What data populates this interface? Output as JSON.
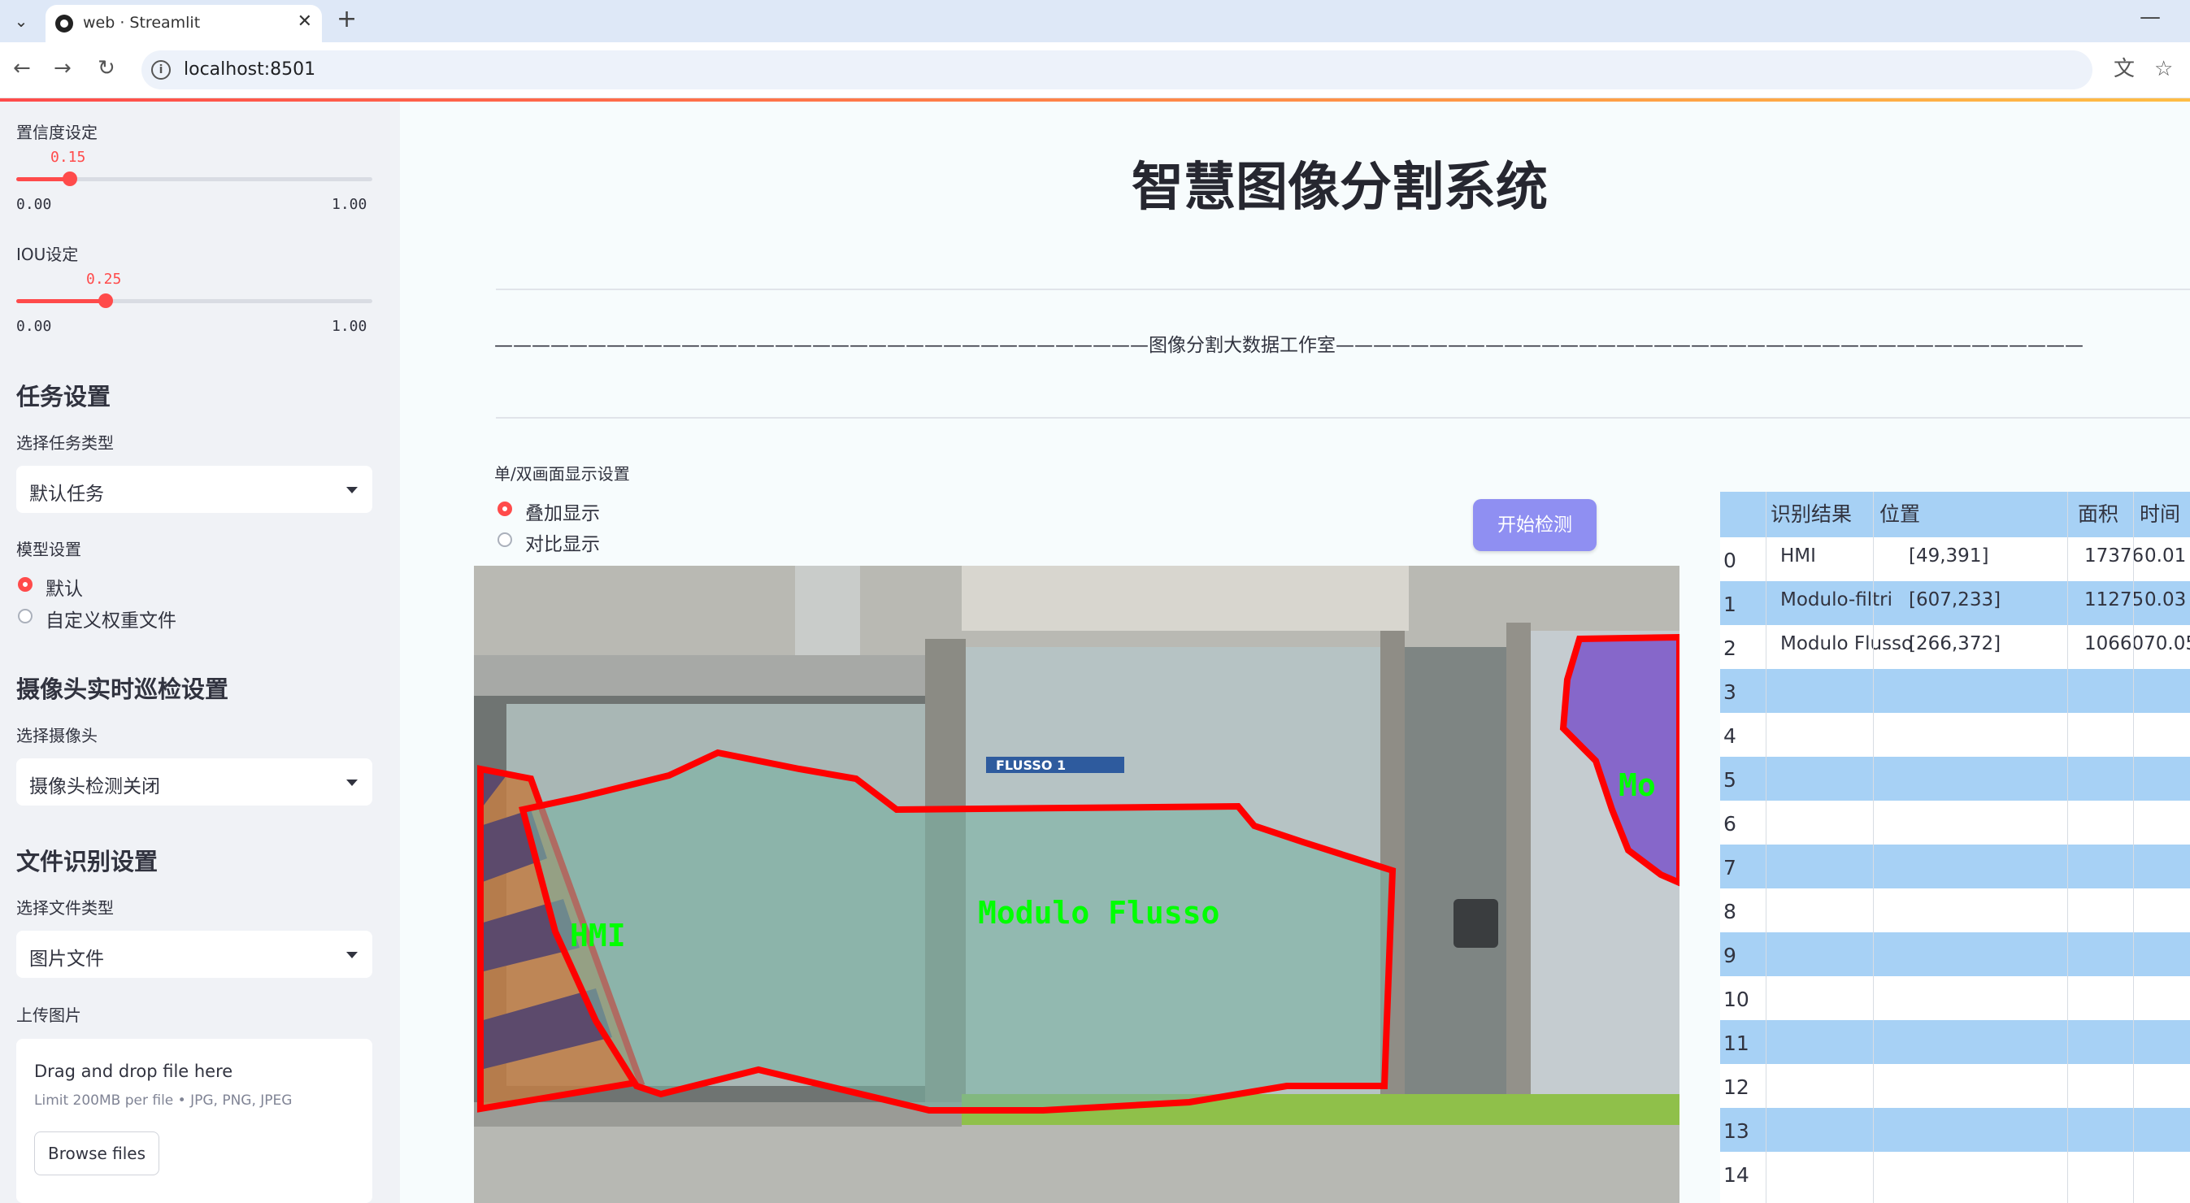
{
  "browser": {
    "tab_title": "web · Streamlit",
    "url": "localhost:8501"
  },
  "sidebar": {
    "confidence": {
      "label": "置信度设定",
      "value": "0.15",
      "fraction": 0.15,
      "min": "0.00",
      "max": "1.00"
    },
    "iou": {
      "label": "IOU设定",
      "value": "0.25",
      "fraction": 0.25,
      "min": "0.00",
      "max": "1.00"
    },
    "task_header": "任务设置",
    "task_type_label": "选择任务类型",
    "task_type_value": "默认任务",
    "model_label": "模型设置",
    "model_options": [
      "默认",
      "自定义权重文件"
    ],
    "model_selected": 0,
    "camera_header": "摄像头实时巡检设置",
    "camera_label": "选择摄像头",
    "camera_value": "摄像头检测关闭",
    "file_header": "文件识别设置",
    "file_type_label": "选择文件类型",
    "file_type_value": "图片文件",
    "upload_label": "上传图片",
    "upload_title": "Drag and drop file here",
    "upload_limit": "Limit 200MB per file • JPG, PNG, JPEG",
    "upload_button": "Browse files"
  },
  "main": {
    "title": "智慧图像分割系统",
    "studio_line": "———————————————————————————————————图像分割大数据工作室————————————————————————————————————————",
    "display_label": "单/双画面显示设置",
    "display_options": [
      "叠加显示",
      "对比显示"
    ],
    "display_selected": 0,
    "detect_button": "开始检测",
    "image_labels": {
      "hmi": "HMI",
      "flusso": "Modulo Flusso",
      "panel_text": "FLUSSO 1",
      "right_partial": "Mo"
    }
  },
  "table": {
    "columns": [
      "识别结果",
      "位置",
      "面积",
      "时间"
    ],
    "rows": [
      {
        "index": "0",
        "result": "HMI",
        "position": "[49,391]",
        "area": "17376",
        "time": "0.01"
      },
      {
        "index": "1",
        "result": "Modulo-filtri",
        "position": "[607,233]",
        "area": "11275",
        "time": "0.03"
      },
      {
        "index": "2",
        "result": "Modulo Flusso",
        "position": "[266,372]",
        "area": "1066070.05",
        "time": ""
      },
      {
        "index": "3",
        "result": "",
        "position": "",
        "area": "",
        "time": ""
      },
      {
        "index": "4",
        "result": "",
        "position": "",
        "area": "",
        "time": ""
      },
      {
        "index": "5",
        "result": "",
        "position": "",
        "area": "",
        "time": ""
      },
      {
        "index": "6",
        "result": "",
        "position": "",
        "area": "",
        "time": ""
      },
      {
        "index": "7",
        "result": "",
        "position": "",
        "area": "",
        "time": ""
      },
      {
        "index": "8",
        "result": "",
        "position": "",
        "area": "",
        "time": ""
      },
      {
        "index": "9",
        "result": "",
        "position": "",
        "area": "",
        "time": ""
      },
      {
        "index": "10",
        "result": "",
        "position": "",
        "area": "",
        "time": ""
      },
      {
        "index": "11",
        "result": "",
        "position": "",
        "area": "",
        "time": ""
      },
      {
        "index": "12",
        "result": "",
        "position": "",
        "area": "",
        "time": ""
      },
      {
        "index": "13",
        "result": "",
        "position": "",
        "area": "",
        "time": ""
      },
      {
        "index": "14",
        "result": "",
        "position": "",
        "area": "",
        "time": ""
      }
    ]
  },
  "colors": {
    "accent": "#ff4b4b",
    "table_stripe": "#a7d1f5",
    "button": "#8f8ff2",
    "mask_green": "#00ff00",
    "mask_red": "#ff0000"
  }
}
